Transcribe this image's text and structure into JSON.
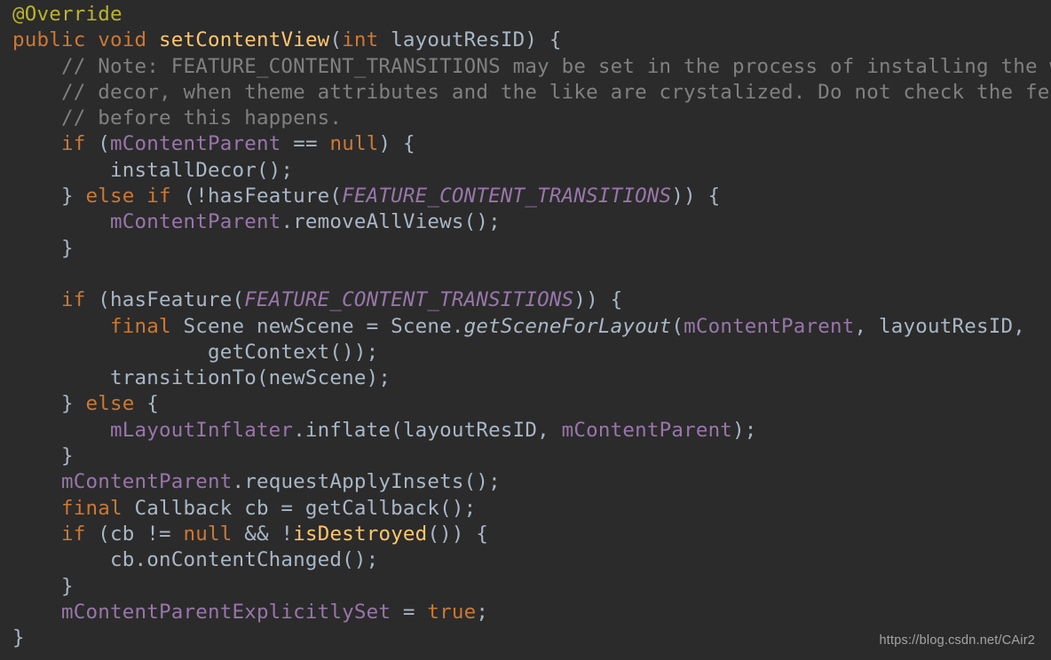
{
  "code": {
    "t1": "@Override",
    "t2a": "public",
    "t2b": "void",
    "t2c": "setContentView",
    "t2d": "int",
    "t2e": "layoutResID",
    "t3": "// Note: FEATURE_CONTENT_TRANSITIONS may be set in the process of installing the window",
    "t4": "// decor, when theme attributes and the like are crystalized. Do not check the feature",
    "t5": "// before this happens.",
    "t6a": "if",
    "t6b": "mContentParent",
    "t6c": "null",
    "t7": "installDecor();",
    "t8a": "else if",
    "t8b": "FEATURE_CONTENT_TRANSITIONS",
    "t9a": "mContentParent",
    "t9b": ".removeAllViews();",
    "t11a": "if",
    "t11b": "FEATURE_CONTENT_TRANSITIONS",
    "t12a": "final",
    "t12b": "getSceneForLayout",
    "t12c": "mContentParent",
    "t12text": " Scene newScene = Scene.",
    "t13": "getContext());",
    "t14": "transitionTo(newScene);",
    "t15a": "else",
    "t16a": "mLayoutInflater",
    "t16b": ".inflate(layoutResID, ",
    "t16c": "mContentParent",
    "t18a": "mContentParent",
    "t18b": ".requestApplyInsets();",
    "t19a": "final",
    "t19b": " Callback cb = getCallback();",
    "t20a": "if",
    "t20b": "null",
    "t20c": "isDestroyed",
    "t21": "cb.onContentChanged();",
    "t23a": "mContentParentExplicitlySet",
    "t23b": "true"
  },
  "watermark": "https://blog.csdn.net/CAir2"
}
